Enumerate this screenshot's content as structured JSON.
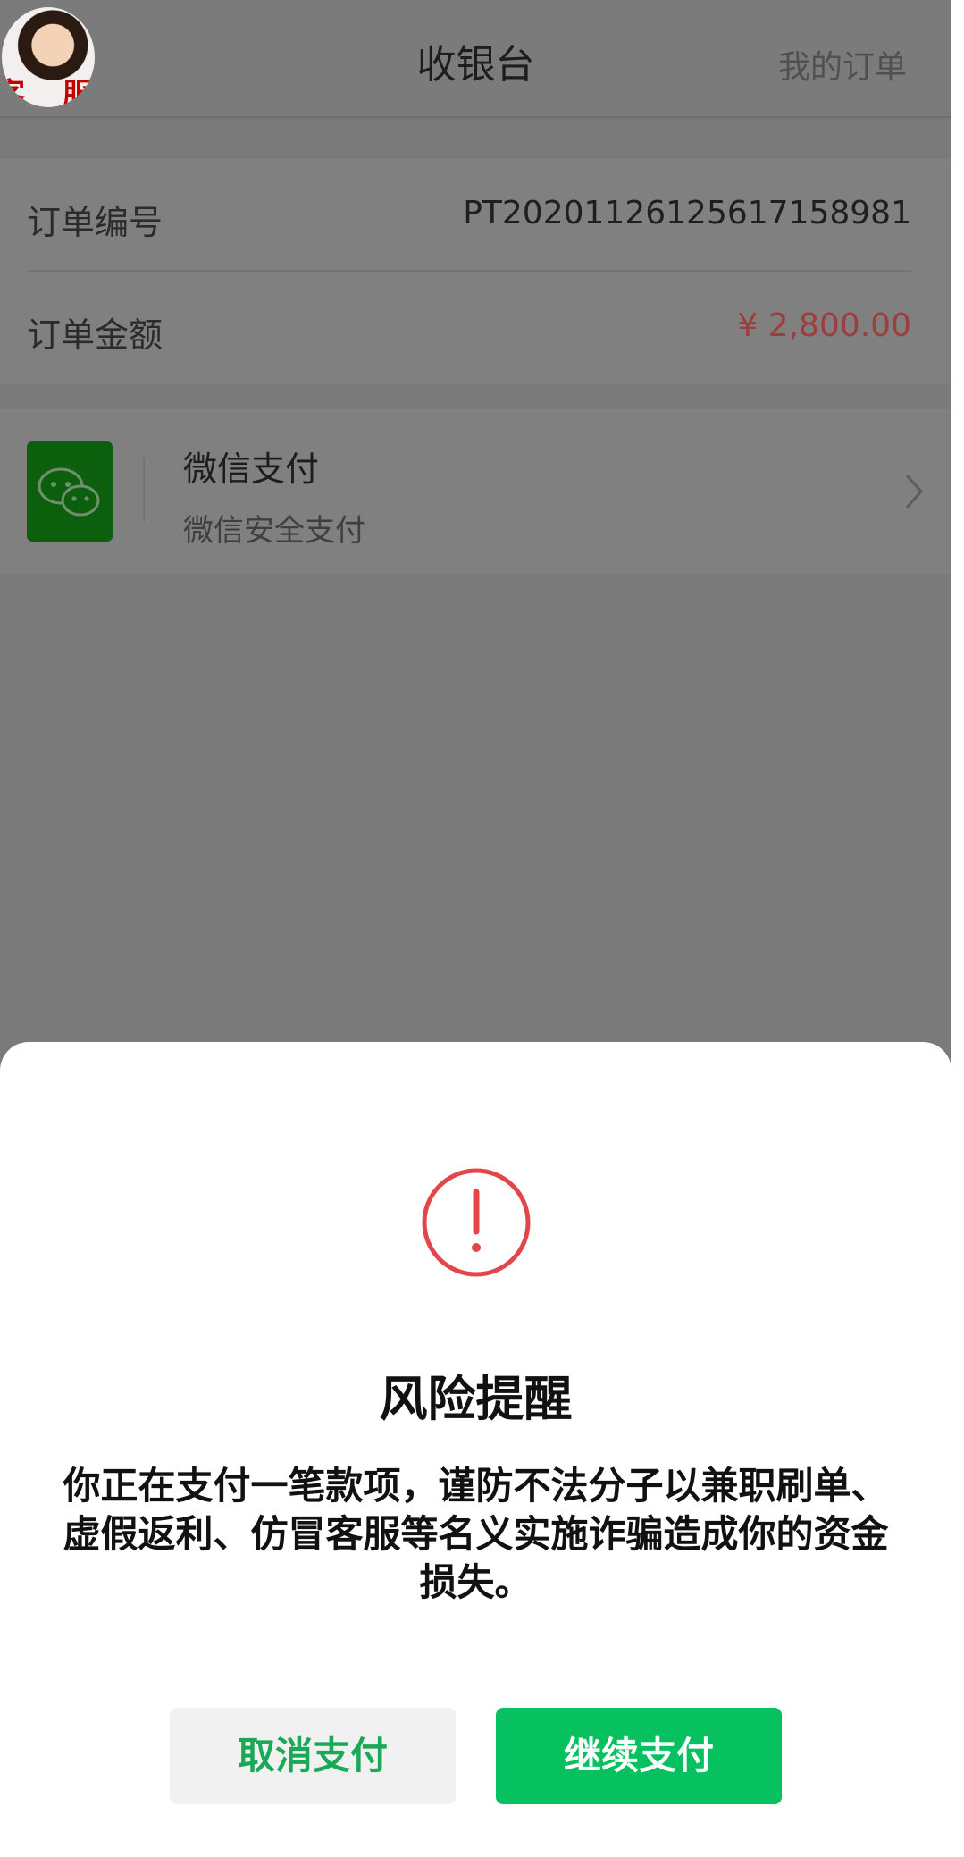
{
  "header": {
    "avatar_text_left": "客",
    "avatar_text_right": "服",
    "title": "收银台",
    "my_orders": "我的订单"
  },
  "order": {
    "number_label": "订单编号",
    "number_value": "PT2020112612561715898​1",
    "amount_label": "订单金额",
    "amount_value": "¥ 2,800.00"
  },
  "payment": {
    "method_title": "微信支付",
    "method_subtitle": "微信安全支付",
    "icon": "wechat-icon"
  },
  "dialog": {
    "icon": "warning-icon",
    "title": "风险提醒",
    "message": "你正在支付一笔款项，谨防不法分子以兼职刷单、虚假返利、仿冒客服等名义实施诈骗造成你的资金损失。",
    "cancel_label": "取消支付",
    "confirm_label": "继续支付"
  },
  "colors": {
    "wechat_green": "#07c160",
    "warning_red": "#e2464a",
    "amount_red": "#d0454b"
  }
}
